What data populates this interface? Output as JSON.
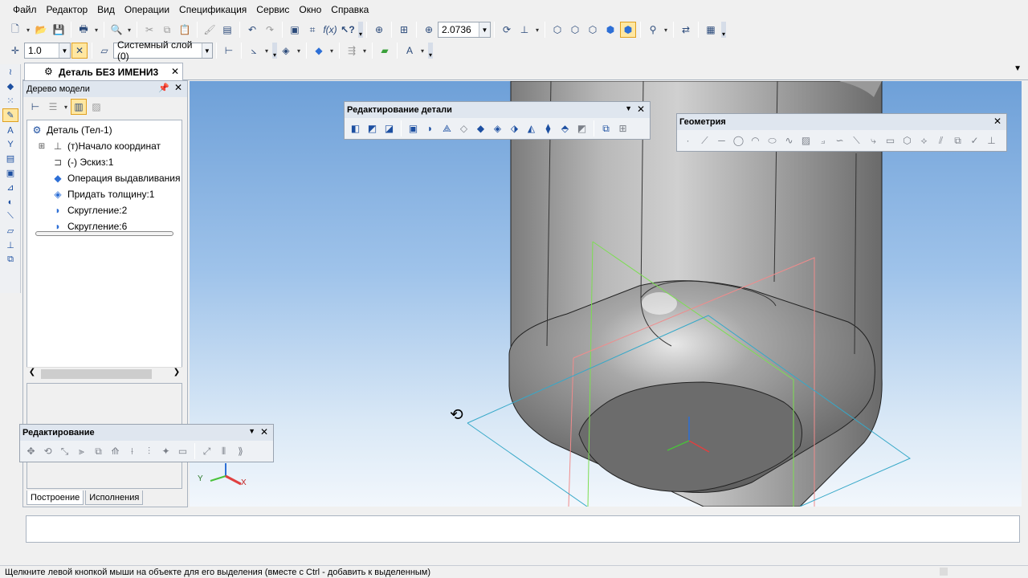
{
  "menu": [
    "Файл",
    "Редактор",
    "Вид",
    "Операции",
    "Спецификация",
    "Сервис",
    "Окно",
    "Справка"
  ],
  "toolbar": {
    "zoom_value": "2.0736",
    "scale_value": "1.0",
    "layer_value": "Системный слой (0)"
  },
  "document_tab": {
    "title": "Деталь БЕЗ ИМЕНИ3"
  },
  "tree_panel": {
    "title": "Дерево модели",
    "items": [
      {
        "label": "Деталь (Тел-1)",
        "icon": "part-icon"
      },
      {
        "label": "(т)Начало координат",
        "icon": "origin-icon"
      },
      {
        "label": "(-) Эскиз:1",
        "icon": "sketch-icon"
      },
      {
        "label": "Операция выдавливания",
        "icon": "extrude-icon"
      },
      {
        "label": "Придать толщину:1",
        "icon": "thicken-icon"
      },
      {
        "label": "Скругление:2",
        "icon": "fillet-icon"
      },
      {
        "label": "Скругление:6",
        "icon": "fillet-icon"
      }
    ],
    "tabs": [
      "Построение",
      "Исполнения"
    ]
  },
  "floating_toolbars": {
    "part_edit": "Редактирование детали",
    "geometry": "Геометрия",
    "editing": "Редактирование"
  },
  "axes": {
    "x": "X",
    "y": "Y"
  },
  "status": {
    "text": "Щелкните левой кнопкой мыши на объекте для его выделения (вместе с Ctrl - добавить к выделенным)"
  },
  "colors": {
    "viewport_top": "#6ea0d8",
    "viewport_bottom": "#f2f7fc",
    "model_body": "#8a8a8a",
    "active_button": "#ffe7a1"
  }
}
